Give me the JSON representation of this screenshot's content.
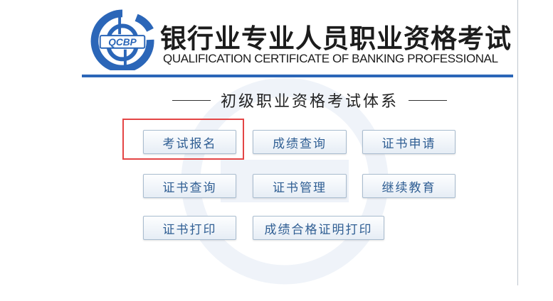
{
  "header": {
    "logo_text": "QCBP",
    "title_cn": "银行业专业人员职业资格考试",
    "title_en": "QUALIFICATION CERTIFICATE OF BANKING PROFESSIONAL"
  },
  "section": {
    "title": "初级职业资格考试体系"
  },
  "buttons": [
    {
      "label": "考试报名"
    },
    {
      "label": "成绩查询"
    },
    {
      "label": "证书申请"
    },
    {
      "label": "证书查询"
    },
    {
      "label": "证书管理"
    },
    {
      "label": "继续教育"
    },
    {
      "label": "证书打印"
    },
    {
      "label": "成绩合格证明打印"
    }
  ],
  "colors": {
    "brand_blue": "#2b66b8",
    "button_text": "#2f5e93",
    "highlight": "#e44545"
  }
}
